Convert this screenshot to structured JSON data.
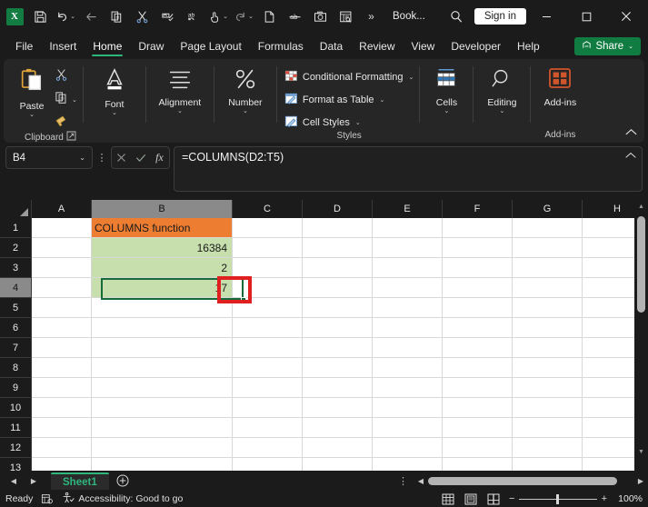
{
  "titlebar": {
    "app_logo": "excel-logo",
    "quick_access": [
      {
        "name": "save-icon",
        "glyph": "save"
      },
      {
        "name": "undo-icon",
        "glyph": "undo",
        "has_caret": true
      },
      {
        "name": "back-arrow-icon",
        "glyph": "back"
      },
      {
        "name": "copy-icon",
        "glyph": "copy"
      },
      {
        "name": "cut-icon",
        "glyph": "cut"
      },
      {
        "name": "format-painter-icon",
        "glyph": "painter"
      },
      {
        "name": "spelling-icon",
        "glyph": "abc"
      },
      {
        "name": "touch-mode-icon",
        "glyph": "touch",
        "has_caret": true
      },
      {
        "name": "redo-icon",
        "glyph": "redo",
        "has_caret": true
      },
      {
        "name": "new-file-icon",
        "glyph": "newfile"
      },
      {
        "name": "strikethrough-icon",
        "glyph": "strike"
      },
      {
        "name": "camera-icon",
        "glyph": "camera"
      },
      {
        "name": "form-icon",
        "glyph": "form"
      }
    ],
    "overflow_label": "»",
    "document_title": "Book...",
    "search_label": "search-icon",
    "sign_in": "Sign in",
    "window_controls": [
      "minimize",
      "maximize",
      "close"
    ]
  },
  "ribbon": {
    "tabs": [
      {
        "label": "File",
        "active": false
      },
      {
        "label": "Insert",
        "active": false
      },
      {
        "label": "Home",
        "active": true
      },
      {
        "label": "Draw",
        "active": false
      },
      {
        "label": "Page Layout",
        "active": false
      },
      {
        "label": "Formulas",
        "active": false
      },
      {
        "label": "Data",
        "active": false
      },
      {
        "label": "Review",
        "active": false
      },
      {
        "label": "View",
        "active": false
      },
      {
        "label": "Developer",
        "active": false
      },
      {
        "label": "Help",
        "active": false
      }
    ],
    "share_label": "Share",
    "groups": {
      "clipboard": {
        "label": "Clipboard",
        "paste": "Paste",
        "cut": "cut-icon",
        "copy": "copy-icon",
        "format_painter": "format-painter-icon"
      },
      "font": {
        "label": "Font"
      },
      "alignment": {
        "label": "Alignment"
      },
      "number": {
        "label": "Number"
      },
      "styles": {
        "label": "Styles",
        "items": [
          {
            "label": "Conditional Formatting"
          },
          {
            "label": "Format as Table"
          },
          {
            "label": "Cell Styles"
          }
        ]
      },
      "cells": {
        "label": "Cells"
      },
      "editing": {
        "label": "Editing"
      },
      "addins": {
        "label": "Add-ins",
        "group_label": "Add-ins"
      }
    }
  },
  "formulabar": {
    "name_box": "B4",
    "cancel_icon": "cancel-icon",
    "enter_icon": "enter-icon",
    "fx_icon": "insert-function-icon",
    "formula": "=COLUMNS(D2:T5)"
  },
  "grid": {
    "columns": [
      {
        "label": "A",
        "width": 66,
        "selected": false
      },
      {
        "label": "B",
        "width": 155,
        "selected": true
      },
      {
        "label": "C",
        "width": 77,
        "selected": false
      },
      {
        "label": "D",
        "width": 77,
        "selected": false
      },
      {
        "label": "E",
        "width": 77,
        "selected": false
      },
      {
        "label": "F",
        "width": 77,
        "selected": false
      },
      {
        "label": "G",
        "width": 77,
        "selected": false
      },
      {
        "label": "H",
        "width": 77,
        "selected": false
      }
    ],
    "rows": [
      {
        "label": "1",
        "selected": false,
        "cells": [
          {
            "value": "",
            "align": "left",
            "bg": "#ffffff"
          },
          {
            "value": "COLUMNS function",
            "align": "left",
            "bg": "#ed7d31"
          },
          {
            "value": "",
            "align": "left",
            "bg": "#ffffff"
          },
          {
            "value": "",
            "align": "left",
            "bg": "#ffffff"
          },
          {
            "value": "",
            "align": "left",
            "bg": "#ffffff"
          },
          {
            "value": "",
            "align": "left",
            "bg": "#ffffff"
          },
          {
            "value": "",
            "align": "left",
            "bg": "#ffffff"
          },
          {
            "value": "",
            "align": "left",
            "bg": "#ffffff"
          }
        ]
      },
      {
        "label": "2",
        "selected": false,
        "cells": [
          {
            "value": "",
            "align": "left",
            "bg": "#ffffff"
          },
          {
            "value": "16384",
            "align": "right",
            "bg": "#c6dfac"
          },
          {
            "value": "",
            "align": "left",
            "bg": "#ffffff"
          },
          {
            "value": "",
            "align": "left",
            "bg": "#ffffff"
          },
          {
            "value": "",
            "align": "left",
            "bg": "#ffffff"
          },
          {
            "value": "",
            "align": "left",
            "bg": "#ffffff"
          },
          {
            "value": "",
            "align": "left",
            "bg": "#ffffff"
          },
          {
            "value": "",
            "align": "left",
            "bg": "#ffffff"
          }
        ]
      },
      {
        "label": "3",
        "selected": false,
        "cells": [
          {
            "value": "",
            "align": "left",
            "bg": "#ffffff"
          },
          {
            "value": "2",
            "align": "right",
            "bg": "#c6dfac"
          },
          {
            "value": "",
            "align": "left",
            "bg": "#ffffff"
          },
          {
            "value": "",
            "align": "left",
            "bg": "#ffffff"
          },
          {
            "value": "",
            "align": "left",
            "bg": "#ffffff"
          },
          {
            "value": "",
            "align": "left",
            "bg": "#ffffff"
          },
          {
            "value": "",
            "align": "left",
            "bg": "#ffffff"
          },
          {
            "value": "",
            "align": "left",
            "bg": "#ffffff"
          }
        ]
      },
      {
        "label": "4",
        "selected": true,
        "cells": [
          {
            "value": "",
            "align": "left",
            "bg": "#ffffff"
          },
          {
            "value": "17",
            "align": "right",
            "bg": "#c6dfac"
          },
          {
            "value": "",
            "align": "left",
            "bg": "#ffffff"
          },
          {
            "value": "",
            "align": "left",
            "bg": "#ffffff"
          },
          {
            "value": "",
            "align": "left",
            "bg": "#ffffff"
          },
          {
            "value": "",
            "align": "left",
            "bg": "#ffffff"
          },
          {
            "value": "",
            "align": "left",
            "bg": "#ffffff"
          },
          {
            "value": "",
            "align": "left",
            "bg": "#ffffff"
          }
        ]
      },
      {
        "label": "5",
        "selected": false,
        "cells": []
      },
      {
        "label": "6",
        "selected": false,
        "cells": []
      },
      {
        "label": "7",
        "selected": false,
        "cells": []
      },
      {
        "label": "8",
        "selected": false,
        "cells": []
      },
      {
        "label": "9",
        "selected": false,
        "cells": []
      },
      {
        "label": "10",
        "selected": false,
        "cells": []
      },
      {
        "label": "11",
        "selected": false,
        "cells": []
      },
      {
        "label": "12",
        "selected": false,
        "cells": []
      },
      {
        "label": "13",
        "selected": false,
        "cells": []
      }
    ],
    "selection": {
      "cell": "B4",
      "border_color": "#176b3a"
    },
    "annotation": {
      "shape": "rectangle",
      "color": "#e02020",
      "targets": "B4"
    }
  },
  "sheetbar": {
    "prev_label": "◀",
    "next_label": "▶",
    "tabs": [
      {
        "label": "Sheet1",
        "active": true
      }
    ],
    "add_label": "+",
    "options_label": "⋮"
  },
  "statusbar": {
    "mode": "Ready",
    "macro_icon": "record-macro-icon",
    "accessibility_icon": "accessibility-icon",
    "accessibility": "Accessibility: Good to go",
    "views": [
      {
        "name": "normal-view-button"
      },
      {
        "name": "page-layout-view-button"
      },
      {
        "name": "page-break-preview-button"
      }
    ],
    "zoom_out": "−",
    "zoom_in": "+",
    "zoom": "100%"
  }
}
